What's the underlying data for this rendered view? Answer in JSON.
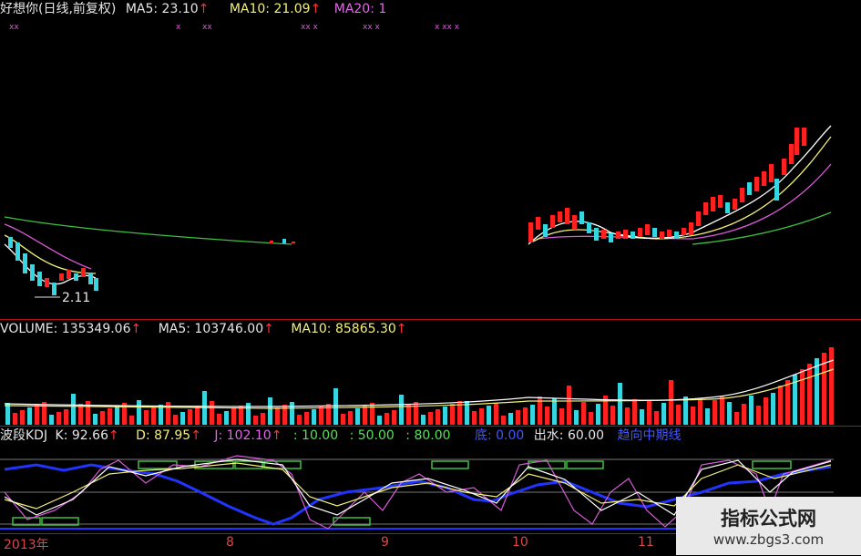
{
  "price_panel": {
    "title": "好想你(日线,前复权)",
    "ma5": "MA5: 23.10",
    "ma10": "MA10: 21.09",
    "ma20": "MA20: 1",
    "low_mark": "2.11",
    "arrow": "↑"
  },
  "volume_panel": {
    "volume": "VOLUME: 135349.06",
    "ma5": "MA5: 103746.00",
    "ma10": "MA10: 85865.30",
    "arrow": "↑"
  },
  "kdj_panel": {
    "name": "波段KDJ",
    "k": "K: 92.66",
    "d": "D: 87.95",
    "j": "J: 102.10",
    "l1": ": 10.00",
    "l2": ": 50.00",
    "l3": ": 80.00",
    "bottom": "底: 0.00",
    "exit": "出水: 60.00",
    "trend": "趋向中期线",
    "arrow": "↑"
  },
  "x_axis": {
    "labels": [
      "2013年",
      "8",
      "9",
      "10",
      "11"
    ]
  },
  "watermark": {
    "main": "指标公式网",
    "sub": "www.zbgs3.com"
  },
  "colors": {
    "background": "#000000",
    "divider": "#b01010",
    "up": "#ff2020",
    "down": "#36d6e0",
    "ma5": "#ffffff",
    "ma10": "#f3f07a",
    "ma20": "#d85ad8",
    "ma60": "#40c040",
    "kdj_blue": "#2233ff"
  }
}
